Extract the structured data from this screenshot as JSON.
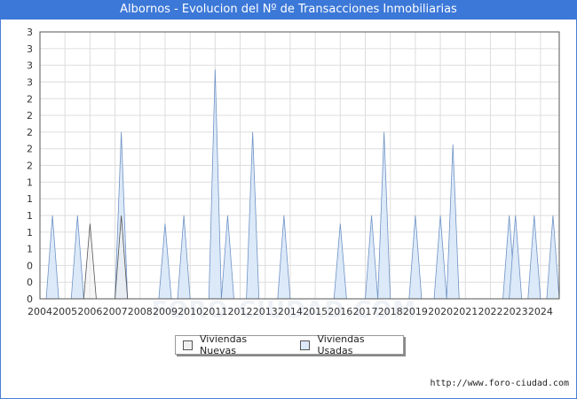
{
  "title": "Albornos - Evolucion del Nº de Transacciones Inmobiliarias",
  "footer_url": "http://www.foro-ciudad.com",
  "watermark": "FORO-CIUDAD.COM",
  "colors": {
    "title_bg": "#3c78d8",
    "nuevas_fill": "#f0f0f0",
    "nuevas_stroke": "#555555",
    "usadas_fill": "#dce9f8",
    "usadas_stroke": "#6f93c6",
    "grid": "#dddddd"
  },
  "chart_data": {
    "type": "area",
    "title": "Albornos - Evolucion del Nº de Transacciones Inmobiliarias",
    "xlabel": "",
    "ylabel": "",
    "x_range": [
      2004,
      2024.75
    ],
    "ylim": [
      0,
      3.2
    ],
    "y_tick_values": [
      0,
      0.2,
      0.4,
      0.6,
      0.8,
      1.0,
      1.2,
      1.4,
      1.6,
      1.8,
      2.0,
      2.2,
      2.4,
      2.6,
      2.8,
      3.0,
      3.2
    ],
    "y_tick_labels": [
      "0",
      "0",
      "0",
      "1",
      "1",
      "1",
      "1",
      "1",
      "2",
      "2",
      "2",
      "2",
      "2",
      "3",
      "3",
      "3",
      "3"
    ],
    "x_tick_labels": [
      "2004",
      "2005",
      "2006",
      "2007",
      "2008",
      "2009",
      "2010",
      "2011",
      "2012",
      "2013",
      "2014",
      "2015",
      "2016",
      "2017",
      "2018",
      "2019",
      "2020",
      "2021",
      "2022",
      "2023",
      "2024"
    ],
    "grid": true,
    "legend_position": "bottom-center",
    "series": [
      {
        "name": "Viviendas Nuevas",
        "peaks": [
          {
            "t": 2006.0,
            "v": 0.9
          },
          {
            "t": 2007.25,
            "v": 1.0
          }
        ]
      },
      {
        "name": "Viviendas Usadas",
        "peaks": [
          {
            "t": 2004.5,
            "v": 1.0
          },
          {
            "t": 2005.5,
            "v": 1.0
          },
          {
            "t": 2007.25,
            "v": 2.0
          },
          {
            "t": 2009.0,
            "v": 0.9
          },
          {
            "t": 2009.75,
            "v": 1.0
          },
          {
            "t": 2011.0,
            "v": 2.75
          },
          {
            "t": 2011.5,
            "v": 1.0
          },
          {
            "t": 2012.5,
            "v": 2.0
          },
          {
            "t": 2013.75,
            "v": 1.0
          },
          {
            "t": 2016.0,
            "v": 0.9
          },
          {
            "t": 2017.25,
            "v": 1.0
          },
          {
            "t": 2017.75,
            "v": 2.0
          },
          {
            "t": 2019.0,
            "v": 1.0
          },
          {
            "t": 2020.0,
            "v": 1.0
          },
          {
            "t": 2020.5,
            "v": 1.85
          },
          {
            "t": 2022.75,
            "v": 1.0
          },
          {
            "t": 2023.0,
            "v": 1.0
          },
          {
            "t": 2023.75,
            "v": 1.0
          },
          {
            "t": 2024.5,
            "v": 1.0
          }
        ]
      }
    ]
  }
}
